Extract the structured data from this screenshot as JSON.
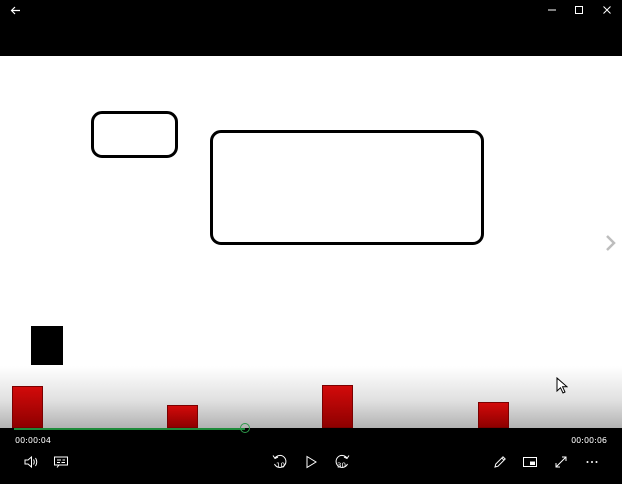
{
  "titlebar": {
    "back_icon": "arrow-left-icon",
    "minimize_icon": "minimize-icon",
    "maximize_icon": "maximize-icon",
    "close_icon": "close-icon"
  },
  "player": {
    "elapsed_time": "00:00:04",
    "remaining_time": "00:00:06",
    "progress": 0.39
  },
  "controls": {
    "volume_icon": "volume-icon",
    "captions_icon": "captions-icon",
    "skip_back_label": "10",
    "play_icon": "play-icon",
    "skip_forward_label": "30",
    "edit_icon": "pencil-icon",
    "mini_view_icon": "mini-view-icon",
    "fullscreen_icon": "fullscreen-icon",
    "more_icon": "more-icon"
  },
  "colors": {
    "progress": "#1e8a3a",
    "block": "#c00000"
  }
}
